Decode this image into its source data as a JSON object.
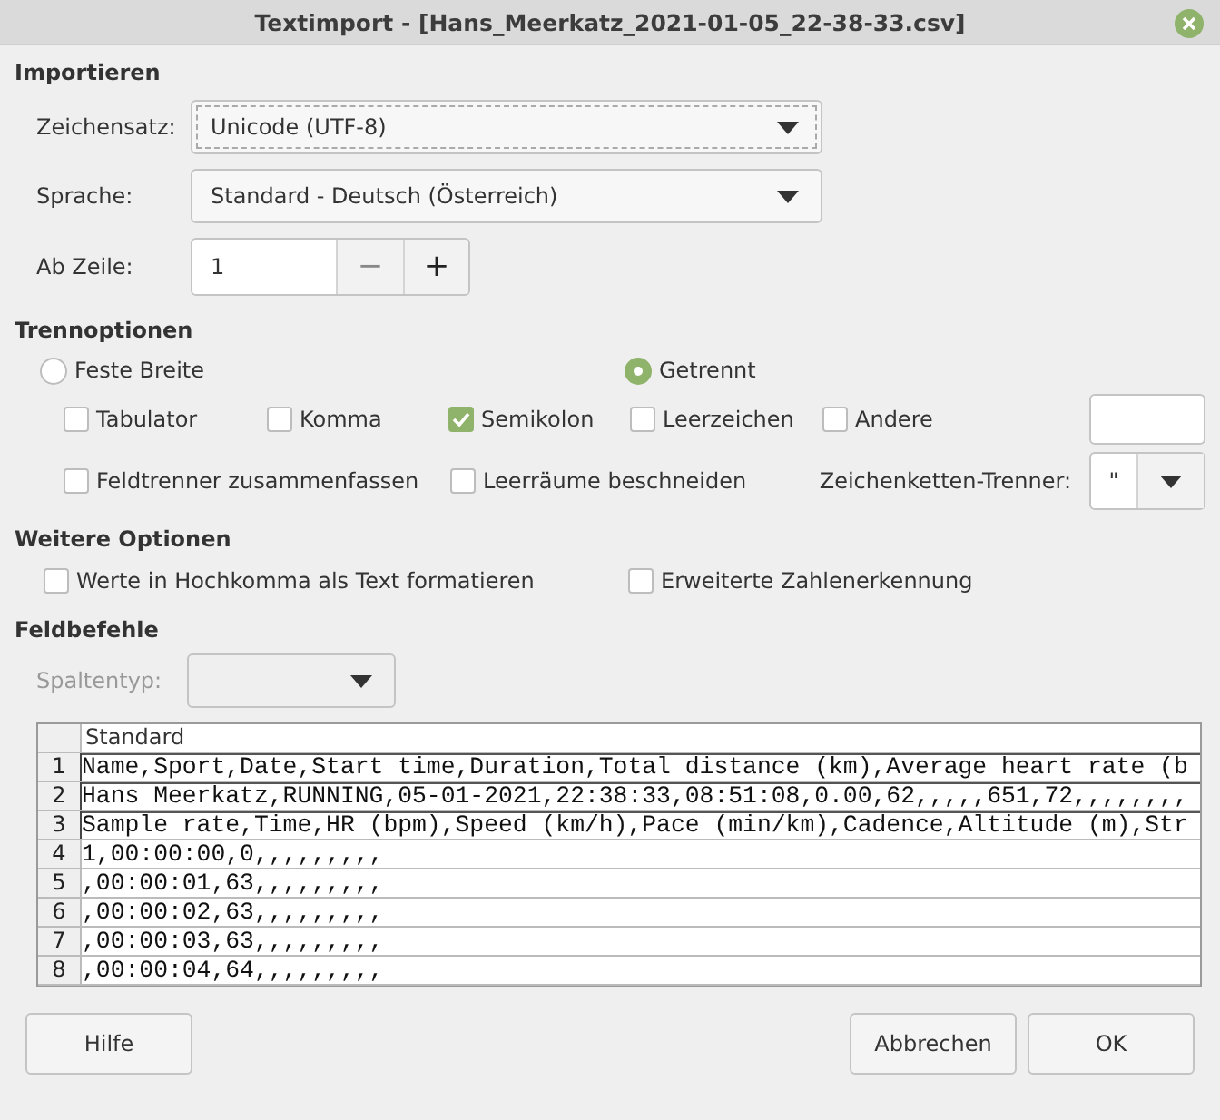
{
  "window": {
    "title": "Textimport - [Hans_Meerkatz_2021-01-05_22-38-33.csv]"
  },
  "import": {
    "heading": "Importieren",
    "charset": {
      "label": "Zeichensatz:",
      "value": "Unicode (UTF-8)"
    },
    "language": {
      "label": "Sprache:",
      "value": "Standard - Deutsch (Österreich)"
    },
    "from_row": {
      "label": "Ab Zeile:",
      "value": "1",
      "minus": "−",
      "plus": "+"
    }
  },
  "separator_options": {
    "heading": "Trennoptionen",
    "modes": [
      {
        "label": "Feste Breite",
        "selected": false
      },
      {
        "label": "Getrennt",
        "selected": true
      }
    ],
    "separators": [
      {
        "label": "Tabulator",
        "checked": false
      },
      {
        "label": "Komma",
        "checked": false
      },
      {
        "label": "Semikolon",
        "checked": true
      },
      {
        "label": "Leerzeichen",
        "checked": false
      },
      {
        "label": "Andere",
        "checked": false
      }
    ],
    "flags": [
      {
        "label": "Feldtrenner zusammenfassen",
        "checked": false
      },
      {
        "label": "Leerräume beschneiden",
        "checked": false
      }
    ],
    "string_delimiter": {
      "label": "Zeichenketten-Trenner:",
      "value": "\""
    }
  },
  "more_options": {
    "heading": "Weitere Optionen",
    "flags": [
      {
        "label": "Werte in Hochkomma als Text formatieren",
        "checked": false
      },
      {
        "label": "Erweiterte Zahlenerkennung",
        "checked": false
      }
    ]
  },
  "field_commands": {
    "heading": "Feldbefehle",
    "column_type": {
      "label": "Spaltentyp:",
      "disabled": true
    }
  },
  "preview": {
    "column": "Standard",
    "rows": [
      {
        "number": "1",
        "text": "Name,Sport,Date,Start time,Duration,Total distance (km),Average heart rate (b",
        "selected": true
      },
      {
        "number": "2",
        "text": "Hans Meerkatz,RUNNING,05-01-2021,22:38:33,08:51:08,0.00,62,,,,,651,72,,,,,,,,",
        "selected": true
      },
      {
        "number": "3",
        "text": "Sample rate,Time,HR (bpm),Speed (km/h),Pace (min/km),Cadence,Altitude (m),Str",
        "selected": true
      },
      {
        "number": "4",
        "text": "1,00:00:00,0,,,,,,,,,",
        "selected": false
      },
      {
        "number": "5",
        "text": ",00:00:01,63,,,,,,,,,",
        "selected": false
      },
      {
        "number": "6",
        "text": ",00:00:02,63,,,,,,,,,",
        "selected": false
      },
      {
        "number": "7",
        "text": ",00:00:03,63,,,,,,,,,",
        "selected": false
      },
      {
        "number": "8",
        "text": ",00:00:04,64,,,,,,,,,",
        "selected": false
      }
    ]
  },
  "buttons": {
    "help": "Hilfe",
    "cancel": "Abbrechen",
    "ok": "OK"
  }
}
